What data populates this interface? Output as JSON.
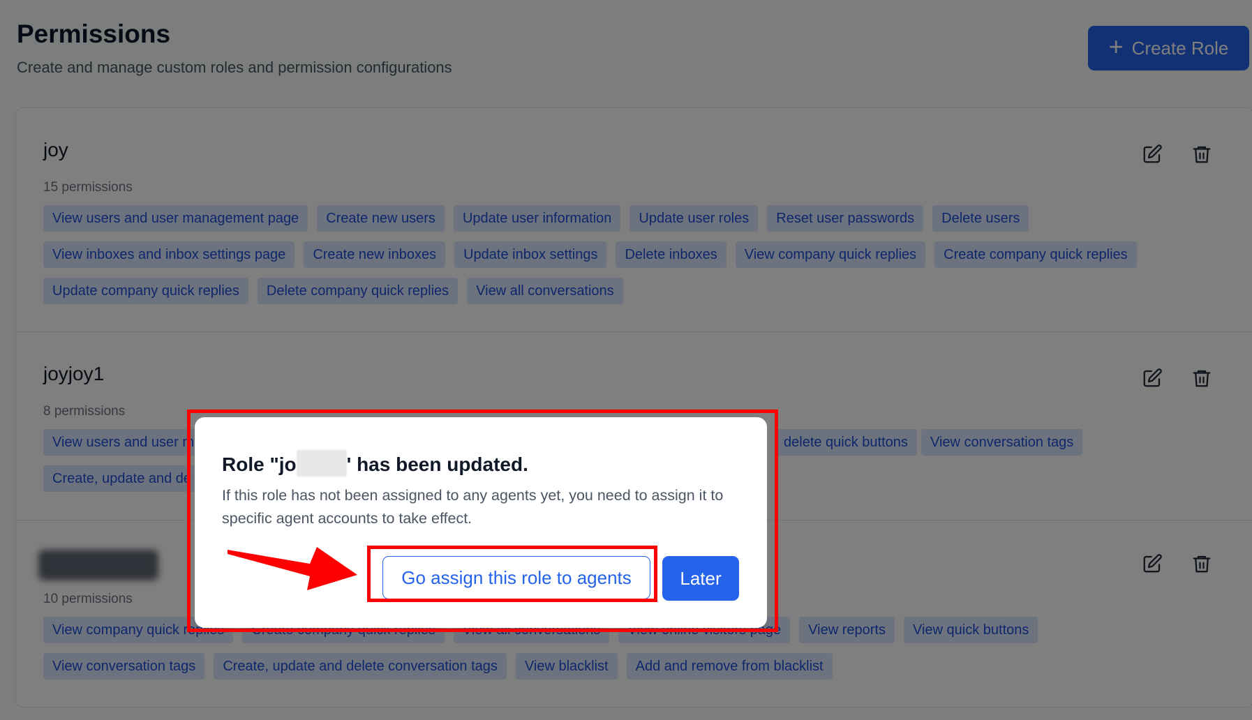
{
  "header": {
    "title": "Permissions",
    "subtitle": "Create and manage custom roles and permission configurations",
    "create_button": "Create Role"
  },
  "roles": [
    {
      "name": "joy",
      "count": "15 permissions",
      "tags": [
        "View users and user management page",
        "Create new users",
        "Update user information",
        "Update user roles",
        "Reset user passwords",
        "Delete users",
        "View inboxes and inbox settings page",
        "Create new inboxes",
        "Update inbox settings",
        "Delete inboxes",
        "View company quick replies",
        "Create company quick replies",
        "Update company quick replies",
        "Delete company quick replies",
        "View all conversations"
      ]
    },
    {
      "name": "joyjoy1",
      "count": "8 permissions",
      "tags": [
        "View users and user m",
        "delete quick buttons",
        "View conversation tags",
        "Create, update and de"
      ]
    },
    {
      "name": "",
      "count": "10 permissions",
      "tags": [
        "View company quick replies",
        "Create company quick replies",
        "View all conversations",
        "View online visitors page",
        "View reports",
        "View quick buttons",
        "View conversation tags",
        "Create, update and delete conversation tags",
        "View blacklist",
        "Add and remove from blacklist"
      ]
    }
  ],
  "modal": {
    "title_prefix": "Role \"jo",
    "title_suffix": "' has been updated.",
    "body": "If this role has not been assigned to any agents yet, you need to assign it to specific agent accounts to take effect.",
    "assign_button": "Go assign this role to agents",
    "later_button": "Later"
  },
  "icons": {
    "edit": "edit-icon",
    "delete": "trash-icon",
    "add": "plus-icon"
  },
  "colors": {
    "accent": "#2563eb",
    "tag_bg": "#dbe6fd",
    "tag_text": "#1d4ed8",
    "highlight": "#ff0000"
  }
}
